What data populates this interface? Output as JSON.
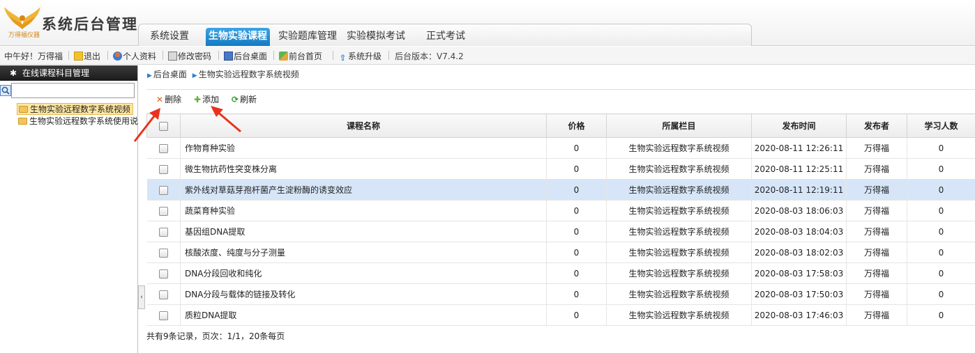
{
  "app": {
    "brand": "系统后台管理",
    "logo_text": "万得福仪器"
  },
  "nav": {
    "tabs": [
      {
        "label": "系统设置",
        "active": false
      },
      {
        "label": "生物实验课程",
        "active": true
      },
      {
        "label": "实验题库管理",
        "active": false
      },
      {
        "label": "实验模拟考试",
        "active": false
      },
      {
        "label": "正式考试",
        "active": false
      }
    ]
  },
  "infobar": {
    "greeting": "中午好！万得福",
    "logout": "退出",
    "profile": "个人资料",
    "change_password": "修改密码",
    "admin_desktop": "后台桌面",
    "front_home": "前台首页",
    "system_upgrade": "系统升级",
    "version": "后台版本：V7.4.2"
  },
  "sidebar": {
    "title": "在线课程科目管理",
    "search_value": "",
    "items": [
      {
        "label": "生物实验远程数字系统视频",
        "selected": true
      },
      {
        "label": "生物实验远程数字系统使用说",
        "selected": false
      }
    ]
  },
  "breadcrumb": {
    "root": "后台桌面",
    "current": "生物实验远程数字系统视频"
  },
  "toolbar": {
    "delete": "删除",
    "add": "添加",
    "refresh": "刷新"
  },
  "table": {
    "columns": [
      "课程名称",
      "价格",
      "所属栏目",
      "发布时间",
      "发布者",
      "学习人数"
    ],
    "rows": [
      {
        "name": "作物育种实验",
        "price": "0",
        "category": "生物实验远程数字系统视频",
        "time": "2020-08-11 12:26:11",
        "author": "万得福",
        "learners": "0",
        "highlight": false
      },
      {
        "name": "微生物抗药性突变株分离",
        "price": "0",
        "category": "生物实验远程数字系统视频",
        "time": "2020-08-11 12:25:11",
        "author": "万得福",
        "learners": "0",
        "highlight": false
      },
      {
        "name": "紫外线对草菇芽孢杆菌产生淀粉酶的诱变效应",
        "price": "0",
        "category": "生物实验远程数字系统视频",
        "time": "2020-08-11 12:19:11",
        "author": "万得福",
        "learners": "0",
        "highlight": true
      },
      {
        "name": "蔬菜育种实验",
        "price": "0",
        "category": "生物实验远程数字系统视频",
        "time": "2020-08-03 18:06:03",
        "author": "万得福",
        "learners": "0",
        "highlight": false
      },
      {
        "name": "基因组DNA提取",
        "price": "0",
        "category": "生物实验远程数字系统视频",
        "time": "2020-08-03 18:04:03",
        "author": "万得福",
        "learners": "0",
        "highlight": false
      },
      {
        "name": "核酸浓度、纯度与分子测量",
        "price": "0",
        "category": "生物实验远程数字系统视频",
        "time": "2020-08-03 18:02:03",
        "author": "万得福",
        "learners": "0",
        "highlight": false
      },
      {
        "name": "DNA分段回收和纯化",
        "price": "0",
        "category": "生物实验远程数字系统视频",
        "time": "2020-08-03 17:58:03",
        "author": "万得福",
        "learners": "0",
        "highlight": false
      },
      {
        "name": "DNA分段与载体的链接及转化",
        "price": "0",
        "category": "生物实验远程数字系统视频",
        "time": "2020-08-03 17:50:03",
        "author": "万得福",
        "learners": "0",
        "highlight": false
      },
      {
        "name": "质粒DNA提取",
        "price": "0",
        "category": "生物实验远程数字系统视频",
        "time": "2020-08-03 17:46:03",
        "author": "万得福",
        "learners": "0",
        "highlight": false
      }
    ]
  },
  "footer": {
    "summary": "共有9条记录，页次：1/1，20条每页"
  },
  "colors": {
    "accent": "#1a86d0",
    "highlight_row": "#d6e6f8",
    "annotation_arrow": "#e8331f"
  }
}
